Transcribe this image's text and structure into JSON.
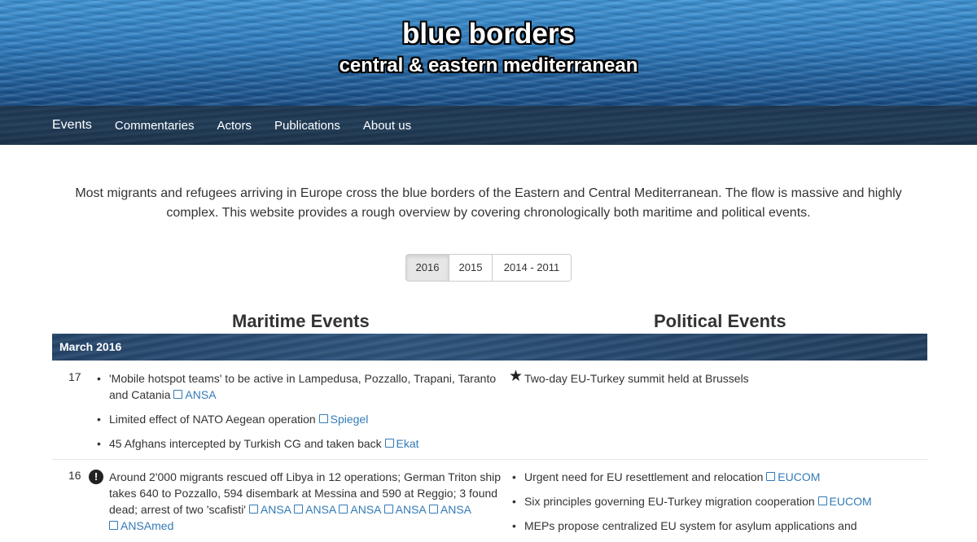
{
  "header": {
    "title": "blue borders",
    "subtitle": "central & eastern mediterranean"
  },
  "nav": [
    "Events",
    "Commentaries",
    "Actors",
    "Publications",
    "About us"
  ],
  "intro": "Most migrants and refugees arriving in Europe cross the blue borders of the Eastern and Central Mediterranean. The flow is massive and highly complex. This website provides a rough overview by covering chronologically both maritime and political events.",
  "year_tabs": [
    "2016",
    "2015",
    "2014 - 2011"
  ],
  "columns": {
    "maritime": "Maritime Events",
    "political": "Political Events"
  },
  "month": "March 2016",
  "days": [
    {
      "day": "17",
      "maritime": [
        {
          "text": "'Mobile hotspot teams' to be active in Lampedusa, Pozzallo, Trapani, Taranto and Catania",
          "sources": [
            "ANSA"
          ]
        },
        {
          "text": "Limited effect of NATO Aegean operation",
          "sources": [
            "Spiegel"
          ]
        },
        {
          "text": "45 Afghans intercepted by Turkish CG and taken back",
          "sources": [
            "Ekat"
          ]
        }
      ],
      "political": [
        {
          "text": "Two-day EU-Turkey summit held at Brussels",
          "sources": []
        }
      ]
    },
    {
      "day": "16",
      "maritime": [
        {
          "text": "Around 2'000 migrants rescued off Libya in 12 operations; German Triton ship takes 640 to Pozzallo, 594 disembark at Messina and 590 at Reggio; 3 found dead; arrest of two 'scafisti'",
          "sources": [
            "ANSA",
            "ANSA",
            "ANSA",
            "ANSA",
            "ANSA",
            "ANSAmed"
          ]
        }
      ],
      "political": [
        {
          "text": "Urgent need for EU resettlement and relocation",
          "sources": [
            "EUCOM"
          ]
        },
        {
          "text": "Six principles governing EU-Turkey migration cooperation",
          "sources": [
            "EUCOM"
          ]
        },
        {
          "text": "MEPs propose centralized EU system for asylum applications and",
          "sources": []
        }
      ]
    }
  ]
}
